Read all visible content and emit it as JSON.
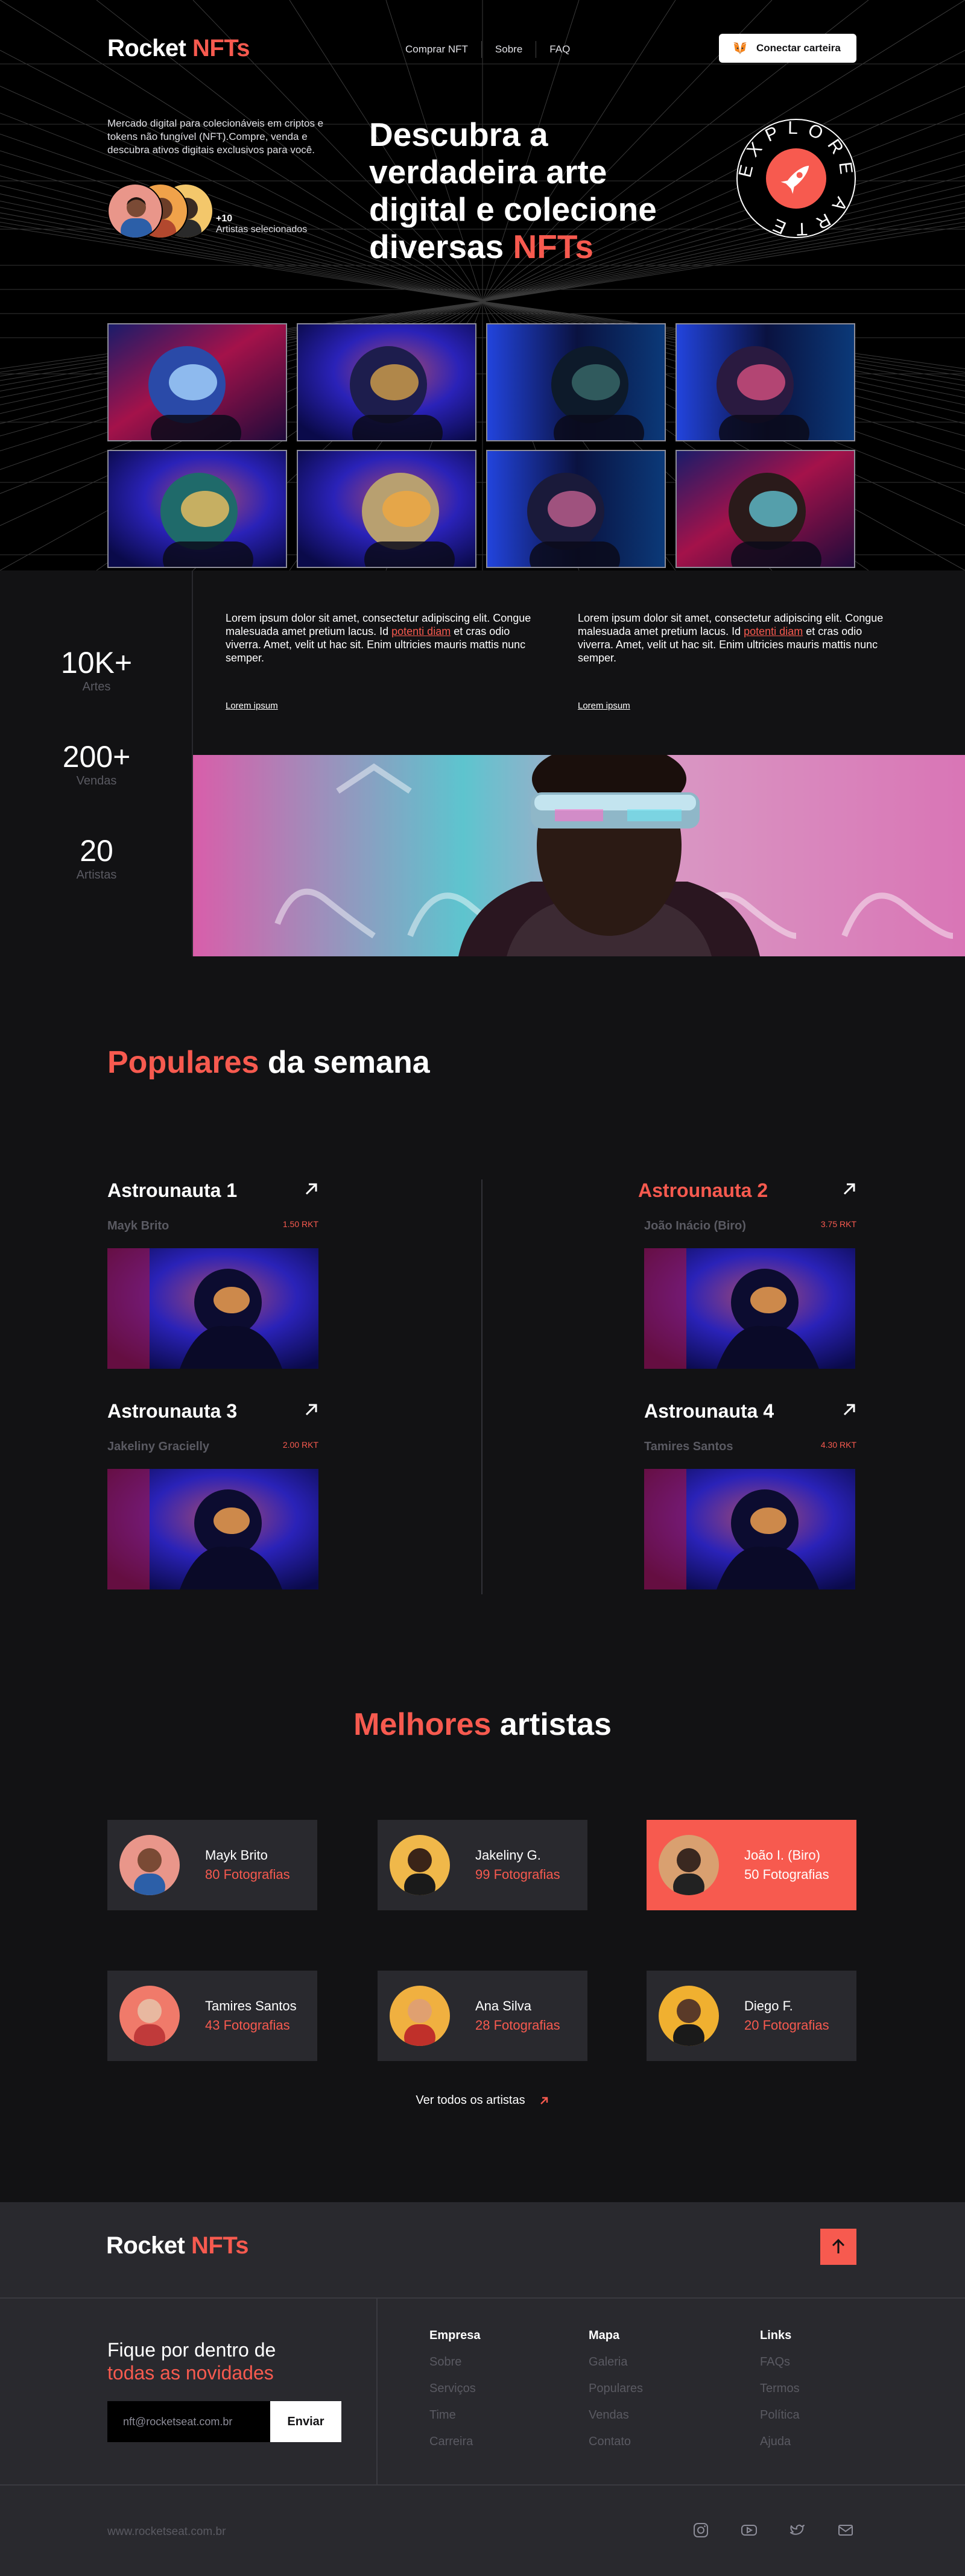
{
  "header": {
    "logo_main": "Rocket",
    "logo_accent": "NFTs",
    "nav": [
      "Comprar NFT",
      "Sobre",
      "FAQ"
    ],
    "connect_label": "Conectar carteira",
    "connect_icon": "metamask-fox-icon"
  },
  "hero": {
    "description": "Mercado digital para colecionáveis em criptos e tokens não fungível (NFT).Compre, venda e descubra ativos digitais exclusivos para você.",
    "artists_count": "+10",
    "artists_label": "Artistas selecionados",
    "title_main": "Descubra a verdadeira arte digital e colecione diversas",
    "title_accent": "NFTs",
    "badge_text": "EXPLORE ARTE"
  },
  "stats": [
    {
      "value": "10K+",
      "label": "Artes"
    },
    {
      "value": "200+",
      "label": "Vendas"
    },
    {
      "value": "20",
      "label": "Artistas"
    }
  ],
  "about": {
    "col1_before": "Lorem ipsum dolor sit amet, consectetur adipiscing elit. Congue malesuada amet pretium lacus. Id ",
    "col1_accent": "potenti diam",
    "col1_after": " et cras odio viverra. Amet, velit ut hac sit. Enim ultricies mauris mattis nunc semper.",
    "col1_link": "Lorem ipsum",
    "col2_before": "Lorem ipsum dolor sit amet, consectetur adipiscing elit. Congue malesuada amet pretium lacus. Id ",
    "col2_accent": "potenti diam",
    "col2_after": " et cras odio viverra. Amet, velit ut hac sit. Enim ultricies mauris mattis nunc semper.",
    "col2_link": "Lorem ipsum"
  },
  "popular": {
    "title_accent": "Populares",
    "title_rest": "da semana",
    "cards": [
      {
        "title": "Astrounauta 1",
        "artist": "Mayk Brito",
        "price": "1.50 RKT"
      },
      {
        "title": "Astrounauta 2",
        "artist": "João Inácio (Biro)",
        "price": "3.75 RKT"
      },
      {
        "title": "Astrounauta 3",
        "artist": "Jakeliny Gracielly",
        "price": "2.00 RKT"
      },
      {
        "title": "Astrounauta 4",
        "artist": "Tamires Santos",
        "price": "4.30 RKT"
      }
    ]
  },
  "artists": {
    "title_accent": "Melhores",
    "title_rest": "artistas",
    "items": [
      {
        "name": "Mayk Brito",
        "count": "80 Fotografias"
      },
      {
        "name": "Jakeliny G.",
        "count": "99 Fotografias"
      },
      {
        "name": "João I. (Biro)",
        "count": "50 Fotografias"
      },
      {
        "name": "Tamires Santos",
        "count": "43 Fotografias"
      },
      {
        "name": "Ana Silva",
        "count": "28 Fotografias"
      },
      {
        "name": "Diego F.",
        "count": "20 Fotografias"
      }
    ],
    "see_all": "Ver todos os artistas"
  },
  "footer": {
    "logo_main": "Rocket",
    "logo_accent": "NFTs",
    "newsletter_line1": "Fique por dentro de",
    "newsletter_line2": "todas as novidades",
    "email_value": "nft@rocketseat.com.br",
    "send_label": "Enviar",
    "columns": [
      {
        "heading": "Empresa",
        "links": [
          "Sobre",
          "Serviços",
          "Time",
          "Carreira"
        ]
      },
      {
        "heading": "Mapa",
        "links": [
          "Galeria",
          "Populares",
          "Vendas",
          "Contato"
        ]
      },
      {
        "heading": "Links",
        "links": [
          "FAQs",
          "Termos",
          "Política",
          "Ajuda"
        ]
      }
    ],
    "site_url": "www.rocketseat.com.br",
    "socials": [
      "instagram-icon",
      "youtube-icon",
      "twitter-icon",
      "mail-icon"
    ]
  },
  "colors": {
    "accent": "#f75a4f",
    "bg": "#121214",
    "card": "#29292e",
    "muted": "#5a5a62"
  }
}
